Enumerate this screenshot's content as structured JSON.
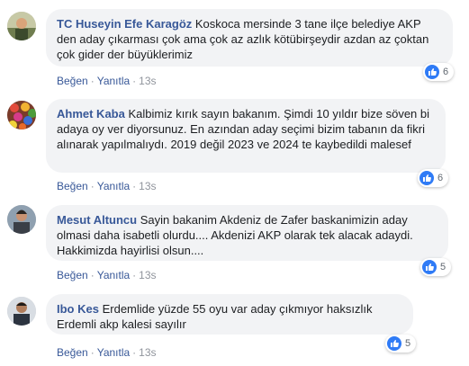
{
  "comments": [
    {
      "author": "TC Huseyin Efe Karagöz",
      "text": "Koskoca mersinde 3 tane ilçe belediye AKP den aday çıkarması çok ama çok az azlık kötübirşeydir azdan az çoktan çok gider der büyüklerimiz",
      "like_label": "Beğen",
      "reply_label": "Yanıtla",
      "time": "13s",
      "reactions": "6"
    },
    {
      "author": "Ahmet Kaba",
      "text": "Kalbimiz kırık sayın bakanım. Şimdi 10 yıldır bize söven bi adaya oy ver diyorsunuz. En azından aday seçimi bizim tabanın da fikri alınarak yapılmalıydı. 2019 değil 2023 ve 2024 te kaybedildi malesef",
      "like_label": "Beğen",
      "reply_label": "Yanıtla",
      "time": "13s",
      "reactions": "6"
    },
    {
      "author": "Mesut Altuncu",
      "text": "Sayin bakanim Akdeniz de Zafer baskanimizin aday olmasi daha isabetli olurdu.... Akdenizi AKP olarak tek alacak adaydi. Hakkimizda hayirlisi olsun....",
      "like_label": "Beğen",
      "reply_label": "Yanıtla",
      "time": "13s",
      "reactions": "5"
    },
    {
      "author": "Ibo Kes",
      "text": "Erdemlide yüzde 55 oyu var aday çıkmıyor haksızlık Erdemli akp kalesi sayılır",
      "like_label": "Beğen",
      "reply_label": "Yanıtla",
      "time": "13s",
      "reactions": "5"
    }
  ],
  "colors": {
    "author": "#385898",
    "bubble": "#f2f3f5",
    "like_badge": "#2f7bf6"
  }
}
